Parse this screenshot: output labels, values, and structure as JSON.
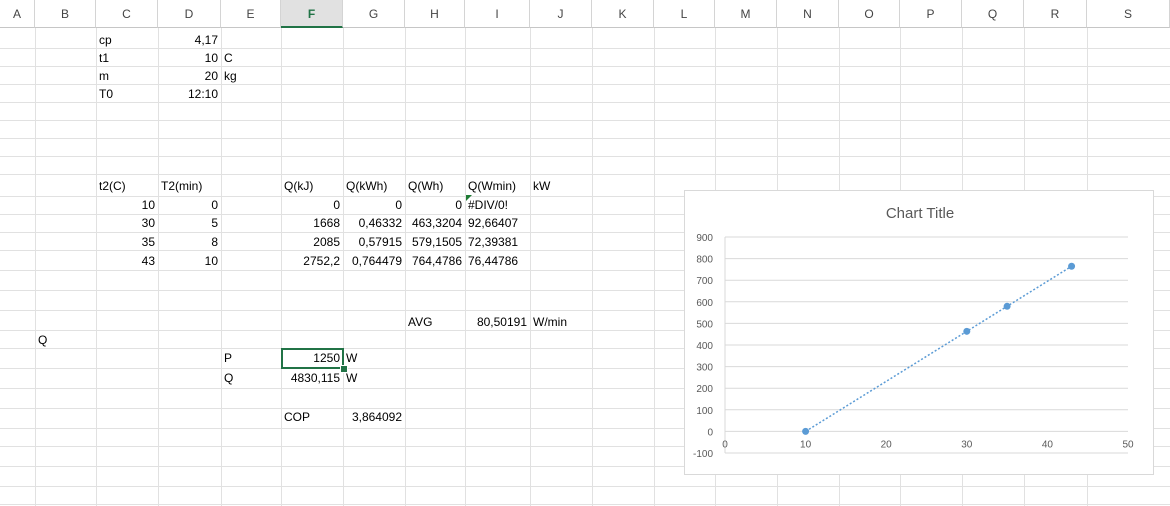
{
  "columns": [
    "A",
    "B",
    "C",
    "D",
    "E",
    "F",
    "G",
    "H",
    "I",
    "J",
    "K",
    "L",
    "M",
    "N",
    "O",
    "P",
    "Q",
    "R",
    "S"
  ],
  "selected_column": "F",
  "cells": {
    "c_cp": "cp",
    "d_cp": "4,17",
    "c_t1": "t1",
    "d_t1": "10",
    "e_t1": "C",
    "c_m": "m",
    "d_m": "20",
    "e_m": "kg",
    "c_T0": "T0",
    "d_T0": "12:10",
    "hdr_t2": "t2(C)",
    "hdr_T2": "T2(min)",
    "hdr_QkJ": "Q(kJ)",
    "hdr_QkWh": "Q(kWh)",
    "hdr_QWh": "Q(Wh)",
    "hdr_QWmin": "Q(Wmin)",
    "hdr_kW": "kW",
    "rows": [
      {
        "t2": "10",
        "T2": "0",
        "QkJ": "0",
        "QkWh": "0",
        "QWh": "0",
        "QWmin": "#DIV/0!"
      },
      {
        "t2": "30",
        "T2": "5",
        "QkJ": "1668",
        "QkWh": "0,46332",
        "QWh": "463,3204",
        "QWmin": "92,66407"
      },
      {
        "t2": "35",
        "T2": "8",
        "QkJ": "2085",
        "QkWh": "0,57915",
        "QWh": "579,1505",
        "QWmin": "72,39381"
      },
      {
        "t2": "43",
        "T2": "10",
        "QkJ": "2752,2",
        "QkWh": "0,764479",
        "QWh": "764,4786",
        "QWmin": "76,44786"
      }
    ],
    "avg_label": "AVG",
    "avg_value": "80,50191",
    "avg_unit": "W/min",
    "a_Q": "Q",
    "e_P": "P",
    "f_P": "1250",
    "g_P": "W",
    "e_Q": "Q",
    "f_Q": "4830,115",
    "g_Q": "W",
    "f_cop": "COP",
    "g_cop": "3,864092"
  },
  "chart_data": {
    "type": "scatter",
    "title": "Chart Title",
    "xlabel": "",
    "ylabel": "",
    "xlim": [
      0,
      50
    ],
    "ylim": [
      -100,
      900
    ],
    "xticks": [
      0,
      10,
      20,
      30,
      40,
      50
    ],
    "yticks": [
      -100,
      0,
      100,
      200,
      300,
      400,
      500,
      600,
      700,
      800,
      900
    ],
    "grid": true,
    "trendline": "linear-dotted",
    "marker_color": "#5b9bd5",
    "series": [
      {
        "x": [
          10,
          30,
          35,
          43
        ],
        "y": [
          0,
          463.3204,
          579.1505,
          764.4786
        ]
      }
    ]
  }
}
